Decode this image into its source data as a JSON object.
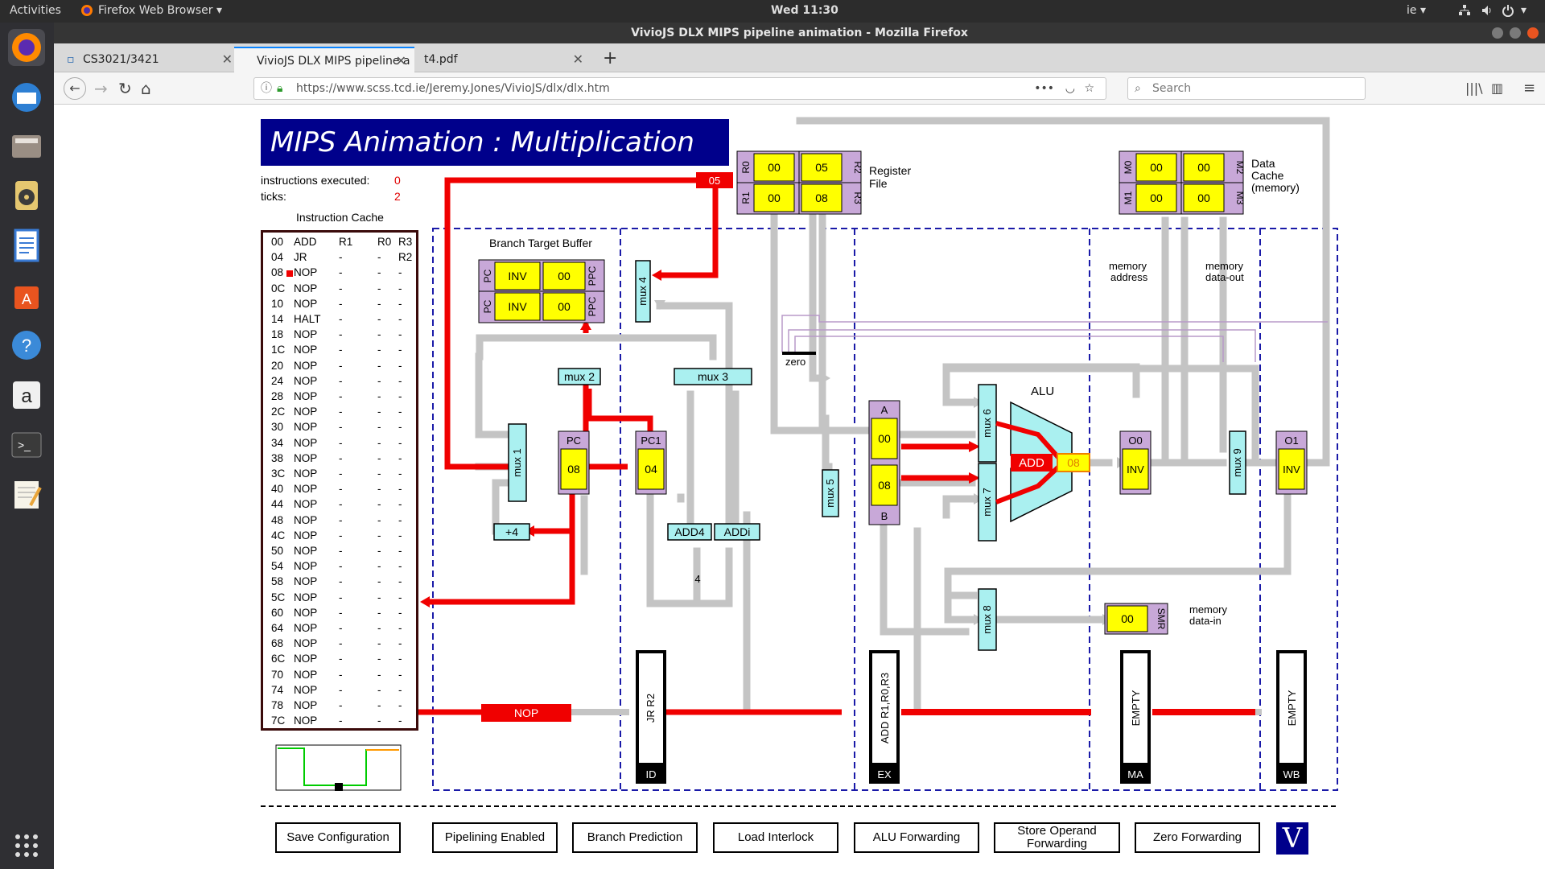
{
  "topbar": {
    "activities": "Activities",
    "app_menu": "Firefox Web Browser ▾",
    "clock": "Wed 11:30",
    "input_lang": "ie ▾"
  },
  "window": {
    "title": "VivioJS DLX MIPS pipeline animation - Mozilla Firefox"
  },
  "tabs": [
    {
      "label": "CS3021/3421"
    },
    {
      "label": "VivioJS DLX MIPS pipeline a"
    },
    {
      "label": "t4.pdf"
    }
  ],
  "navbar": {
    "url": "https://www.scss.tcd.ie/Jeremy.Jones/VivioJS/dlx/dlx.htm",
    "search_placeholder": "Search"
  },
  "page": {
    "title": "MIPS Animation :  Multiplication",
    "instructions_label": "instructions executed:",
    "instructions_value": "0",
    "ticks_label": "ticks:",
    "ticks_value": "2",
    "cache_title": "Instruction Cache",
    "cache_rows": [
      [
        "00",
        "ADD",
        "R1",
        "R0",
        "R3"
      ],
      [
        "04",
        "JR",
        "-",
        "-",
        "R2"
      ],
      [
        "08",
        "NOP",
        "-",
        "-",
        "-"
      ],
      [
        "0C",
        "NOP",
        "-",
        "-",
        "-"
      ],
      [
        "10",
        "NOP",
        "-",
        "-",
        "-"
      ],
      [
        "14",
        "HALT",
        "-",
        "-",
        "-"
      ],
      [
        "18",
        "NOP",
        "-",
        "-",
        "-"
      ],
      [
        "1C",
        "NOP",
        "-",
        "-",
        "-"
      ],
      [
        "20",
        "NOP",
        "-",
        "-",
        "-"
      ],
      [
        "24",
        "NOP",
        "-",
        "-",
        "-"
      ],
      [
        "28",
        "NOP",
        "-",
        "-",
        "-"
      ],
      [
        "2C",
        "NOP",
        "-",
        "-",
        "-"
      ],
      [
        "30",
        "NOP",
        "-",
        "-",
        "-"
      ],
      [
        "34",
        "NOP",
        "-",
        "-",
        "-"
      ],
      [
        "38",
        "NOP",
        "-",
        "-",
        "-"
      ],
      [
        "3C",
        "NOP",
        "-",
        "-",
        "-"
      ],
      [
        "40",
        "NOP",
        "-",
        "-",
        "-"
      ],
      [
        "44",
        "NOP",
        "-",
        "-",
        "-"
      ],
      [
        "48",
        "NOP",
        "-",
        "-",
        "-"
      ],
      [
        "4C",
        "NOP",
        "-",
        "-",
        "-"
      ],
      [
        "50",
        "NOP",
        "-",
        "-",
        "-"
      ],
      [
        "54",
        "NOP",
        "-",
        "-",
        "-"
      ],
      [
        "58",
        "NOP",
        "-",
        "-",
        "-"
      ],
      [
        "5C",
        "NOP",
        "-",
        "-",
        "-"
      ],
      [
        "60",
        "NOP",
        "-",
        "-",
        "-"
      ],
      [
        "64",
        "NOP",
        "-",
        "-",
        "-"
      ],
      [
        "68",
        "NOP",
        "-",
        "-",
        "-"
      ],
      [
        "6C",
        "NOP",
        "-",
        "-",
        "-"
      ],
      [
        "70",
        "NOP",
        "-",
        "-",
        "-"
      ],
      [
        "74",
        "NOP",
        "-",
        "-",
        "-"
      ],
      [
        "78",
        "NOP",
        "-",
        "-",
        "-"
      ],
      [
        "7C",
        "NOP",
        "-",
        "-",
        "-"
      ]
    ],
    "register_file": {
      "label1": "Register",
      "label2": "File",
      "R0": "00",
      "R1": "00",
      "R2": "05",
      "R3": "08",
      "n0": "R0",
      "n1": "R1",
      "n2": "R2",
      "n3": "R3"
    },
    "data_cache": {
      "label1": "Data",
      "label2": "Cache",
      "label3": "(memory)",
      "M0": "00",
      "M1": "00",
      "M2": "00",
      "M3": "00",
      "n0": "M0",
      "n1": "M1",
      "n2": "M2",
      "n3": "M3"
    },
    "btb": {
      "title": "Branch Target Buffer",
      "pc1": "INV",
      "ppc1": "00",
      "pc2": "INV",
      "ppc2": "00",
      "pc_lbl": "PC",
      "ppc_lbl": "PPC"
    },
    "muxes": {
      "mux1": "mux 1",
      "mux2": "mux 2",
      "mux3": "mux 3",
      "mux4": "mux 4",
      "mux5": "mux 5",
      "mux6": "mux 6",
      "mux7": "mux 7",
      "mux8": "mux 8",
      "mux9": "mux 9"
    },
    "regs": {
      "pc_lbl": "PC",
      "pc_val": "08",
      "pc1_lbl": "PC1",
      "pc1_val": "04",
      "a_lbl": "A",
      "a_val": "00",
      "b_lbl": "B",
      "b_val": "08",
      "o0_lbl": "O0",
      "o0_val": "INV",
      "o1_lbl": "O1",
      "o1_val": "INV",
      "smr_lbl": "SMR",
      "smr_val": "00"
    },
    "alu": {
      "label": "ALU",
      "op": "ADD",
      "result": "08"
    },
    "misc": {
      "plus4": "+4",
      "add4": "ADD4",
      "addi": "ADDi",
      "four": "4",
      "zero": "zero",
      "bus_05": "05",
      "bus_nop": "NOP",
      "mem_addr1": "memory",
      "mem_addr2": "address",
      "mem_out1": "memory",
      "mem_out2": "data-out",
      "mem_in1": "memory",
      "mem_in2": "data-in"
    },
    "stages": {
      "id_instr": "JR R2",
      "id_lbl": "ID",
      "ex_instr": "ADD R1,R0,R3",
      "ex_lbl": "EX",
      "ma_instr": "EMPTY",
      "ma_lbl": "MA",
      "wb_instr": "EMPTY",
      "wb_lbl": "WB"
    },
    "buttons": {
      "save": "Save Configuration",
      "pipelining": "Pipelining Enabled",
      "branch": "Branch Prediction",
      "interlock": "Load Interlock",
      "alufwd": "ALU Forwarding",
      "storefwd1": "Store Operand",
      "storefwd2": "Forwarding",
      "zerofwd": "Zero Forwarding",
      "logo": "V"
    }
  }
}
